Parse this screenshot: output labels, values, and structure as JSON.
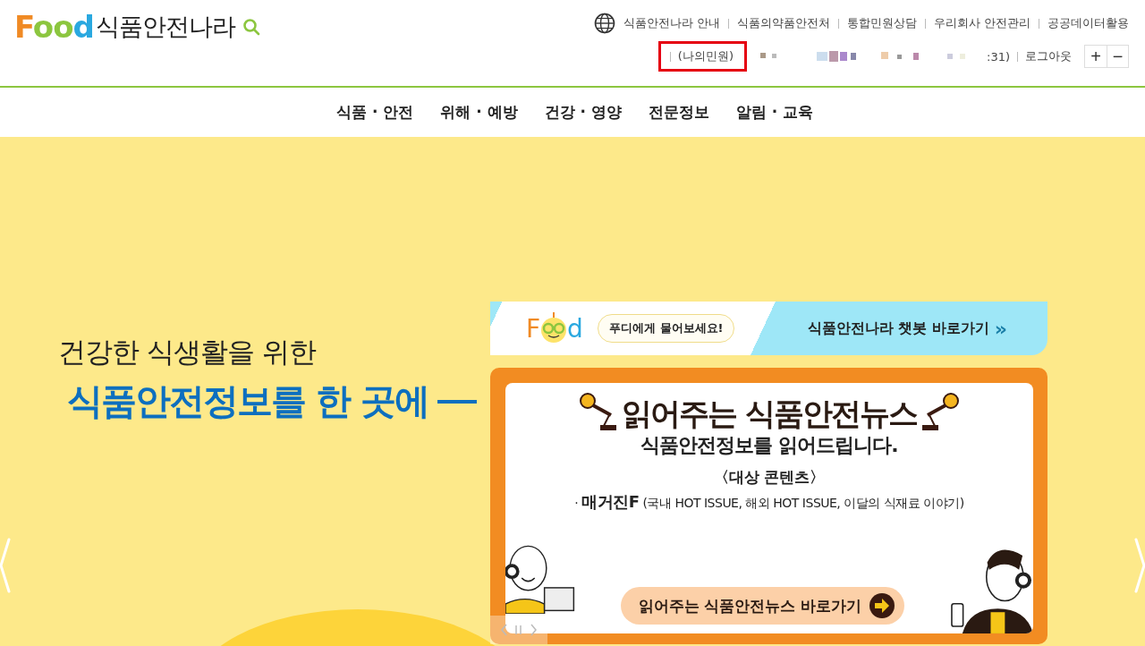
{
  "logo": {
    "letters": [
      {
        "char": "F",
        "color": "#f08a24"
      },
      {
        "char": "o",
        "color": "#8cc63f"
      },
      {
        "char": "o",
        "color": "#8cc63f"
      },
      {
        "char": "d",
        "color": "#29a8e0"
      }
    ],
    "name": "식품안전나라"
  },
  "utility_links": [
    "식품안전나라 안내",
    "식품의약품안전처",
    "통합민원상담",
    "우리회사 안전관리",
    "공공데이터활용"
  ],
  "user_bar": {
    "my_requests": {
      "label": "(나의민원)",
      "highlighted": true
    },
    "session_text": ":31)",
    "logout": "로그아웃",
    "zoom_in": "+",
    "zoom_out": "−"
  },
  "main_nav": [
    "식품 · 안전",
    "위해 · 예방",
    "건강 · 영양",
    "전문정보",
    "알림 · 교육"
  ],
  "hero": {
    "subtitle": "건강한 식생활을 위한",
    "title": "식품안전정보를 한 곳에"
  },
  "chatbot_banner": {
    "logo_letters": [
      "F",
      "d"
    ],
    "bubble": "푸디에게 물어보세요!",
    "link": "식품안전나라 챗봇 바로가기",
    "arrow": "»"
  },
  "news_card": {
    "title": "읽어주는 식품안전뉴스",
    "subtitle": "식품안전정보를 읽어드립니다.",
    "section": "〈대상 콘텐츠〉",
    "item": "· **매거진F** (국내 HOT ISSUE, 해외 HOT ISSUE, 이달의 식재료 이야기)",
    "button": "읽어주는 식품안전뉴스 바로가기"
  }
}
